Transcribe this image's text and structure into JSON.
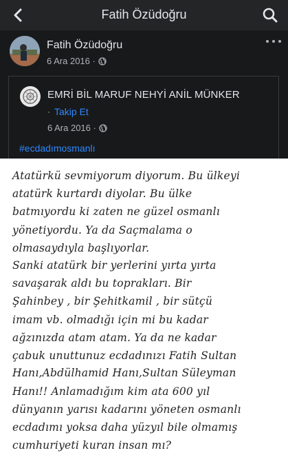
{
  "header": {
    "title": "Fatih Özüdoğru",
    "back_icon": "chevron-left-icon",
    "search_icon": "search-icon"
  },
  "post": {
    "author": "Fatih Özüdoğru",
    "date": "6 Ara 2016 ·",
    "privacy_icon": "globe-icon",
    "shared": {
      "page_name": "EMRİ BİL MARUF NEHYİ ANİL MÜNKER",
      "separator": "·",
      "follow_label": "Takip Et",
      "date": "6 Ara 2016 ·",
      "hashtag": "#ecdadımosmanlı"
    }
  },
  "note": {
    "lines": [
      "Atatürkü sevmiyorum diyorum. Bu ülkeyi",
      "atatürk kurtardı diyolar. Bu ülke",
      "batmıyordu ki zaten ne güzel osmanlı",
      "yönetiyordu. Ya da Saçmalama o",
      "olmasaydıyla başlıyorlar.",
      "Sanki atatürk bir yerlerini yırta yırta",
      "savaşarak aldı bu toprakları. Bir",
      "Şahinbey , bir Şehitkamil , bir sütçü",
      "imam vb. olmadığı için mi bu kadar",
      "ağzınızda atam atam. Ya da ne kadar",
      "çabuk unuttunuz ecdadınızı Fatih Sultan",
      "Hanı,Abdülhamid Hanı,Sultan Süleyman",
      "Hanı!! Anlamadığım kim ata 600 yıl",
      "dünyanın yarısı kadarını yöneten osmanlı",
      "ecdadımı yoksa daha yüzyıl bile olmamış",
      "cumhuriyeti kuran insan mı?"
    ]
  }
}
